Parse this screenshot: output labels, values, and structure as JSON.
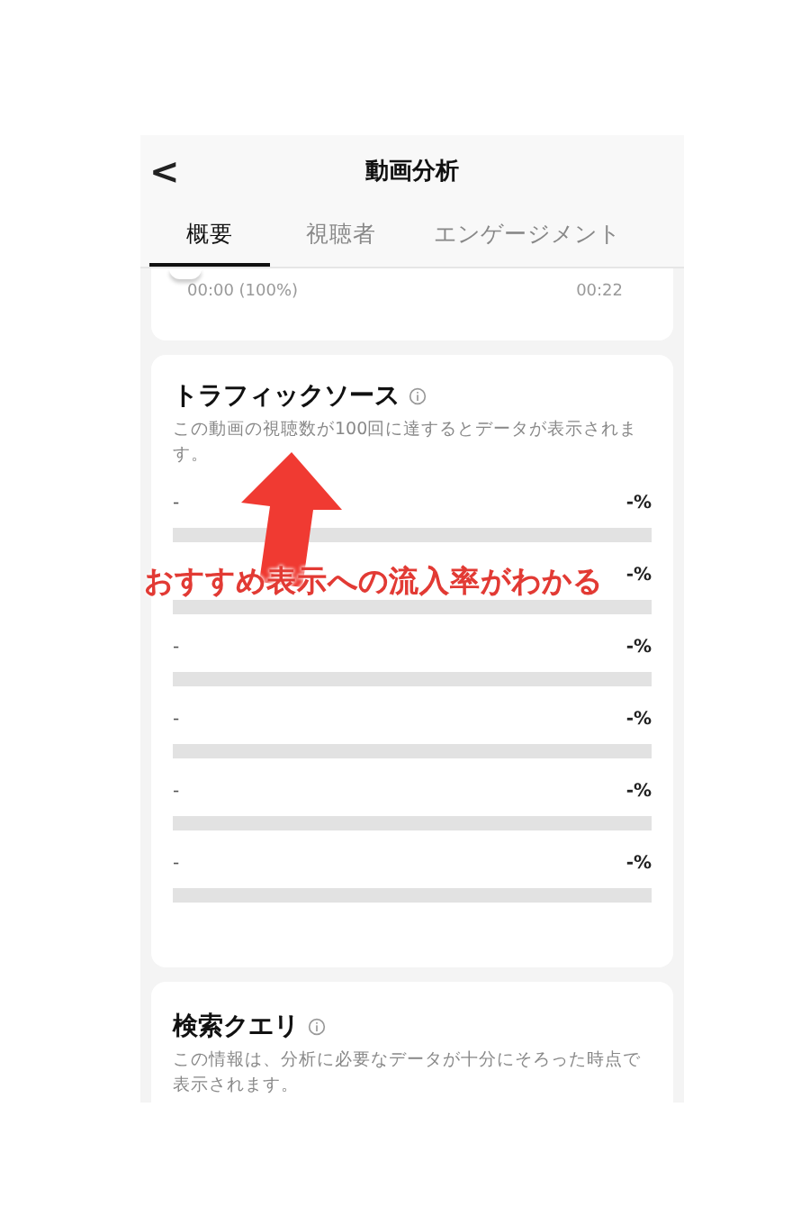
{
  "header": {
    "back": "<",
    "title": "動画分析"
  },
  "tabs": [
    {
      "label": "概要",
      "selected": true
    },
    {
      "label": "視聴者",
      "selected": false
    },
    {
      "label": "エンゲージメント",
      "selected": false
    }
  ],
  "retention": {
    "start": "00:00 (100%)",
    "end": "00:22"
  },
  "traffic": {
    "title": "トラフィックソース",
    "note": "この動画の視聴数が100回に達するとデータが表示されます。",
    "rows": [
      {
        "label": "-",
        "value": "-%"
      },
      {
        "value": "-%"
      },
      {
        "label": "-",
        "value": "-%"
      },
      {
        "label": "-",
        "value": "-%"
      },
      {
        "label": "-",
        "value": "-%"
      },
      {
        "label": "-",
        "value": "-%"
      }
    ]
  },
  "search": {
    "title": "検索クエリ",
    "note": "この情報は、分析に必要なデータが十分にそろった時点で表示されます。"
  },
  "annotation": "おすすめ表示への流入率がわかる"
}
